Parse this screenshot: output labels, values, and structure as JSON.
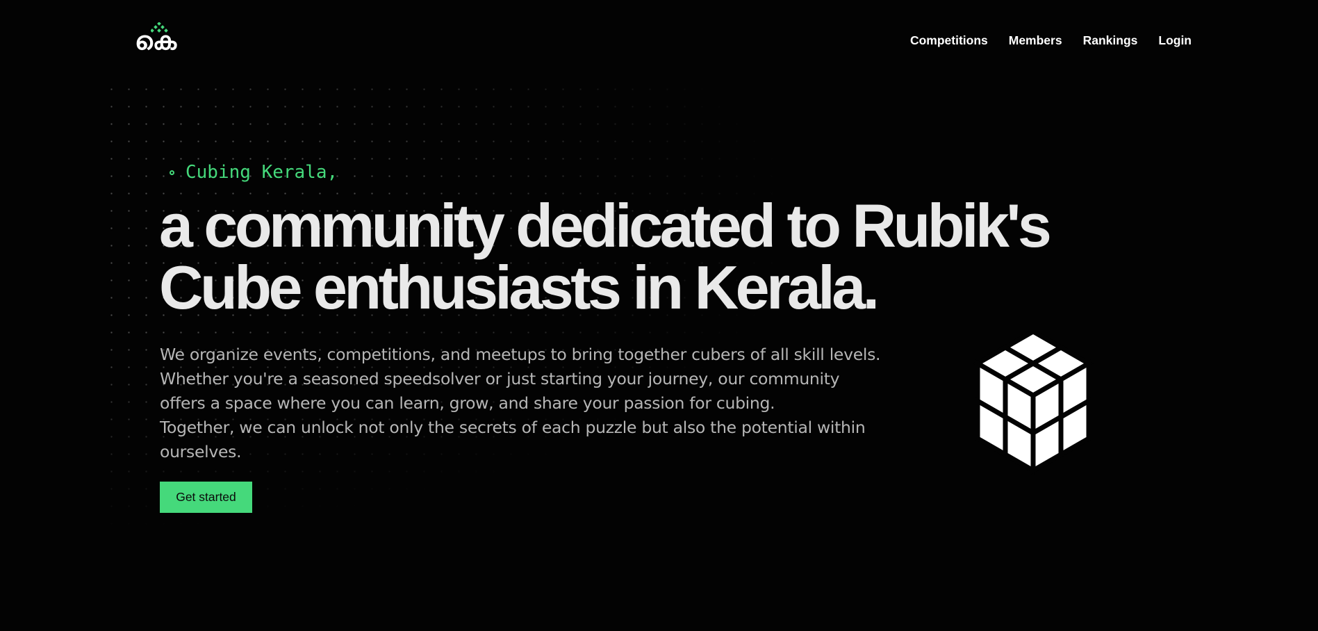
{
  "brand": {
    "logo_text": "കെ",
    "accent_color": "#45d97b"
  },
  "nav": {
    "items": [
      {
        "label": "Competitions"
      },
      {
        "label": "Members"
      },
      {
        "label": "Rankings"
      },
      {
        "label": "Login"
      }
    ]
  },
  "hero": {
    "eyebrow": "Cubing Kerala,",
    "headline_line1": "a community dedicated to Rubik's",
    "headline_line2": "Cube enthusiasts in Kerala.",
    "description_lines": [
      "We organize events, competitions, and meetups to bring together cubers of all skill levels.",
      "Whether you're a seasoned speedsolver or just starting your journey, our community",
      "offers a space where you can learn, grow, and share your passion for cubing.",
      "Together, we can unlock not only the secrets of each puzzle but also the potential within",
      "ourselves."
    ],
    "cta_label": "Get started",
    "illustration_icon": "rubiks-cube-2x2-icon"
  }
}
